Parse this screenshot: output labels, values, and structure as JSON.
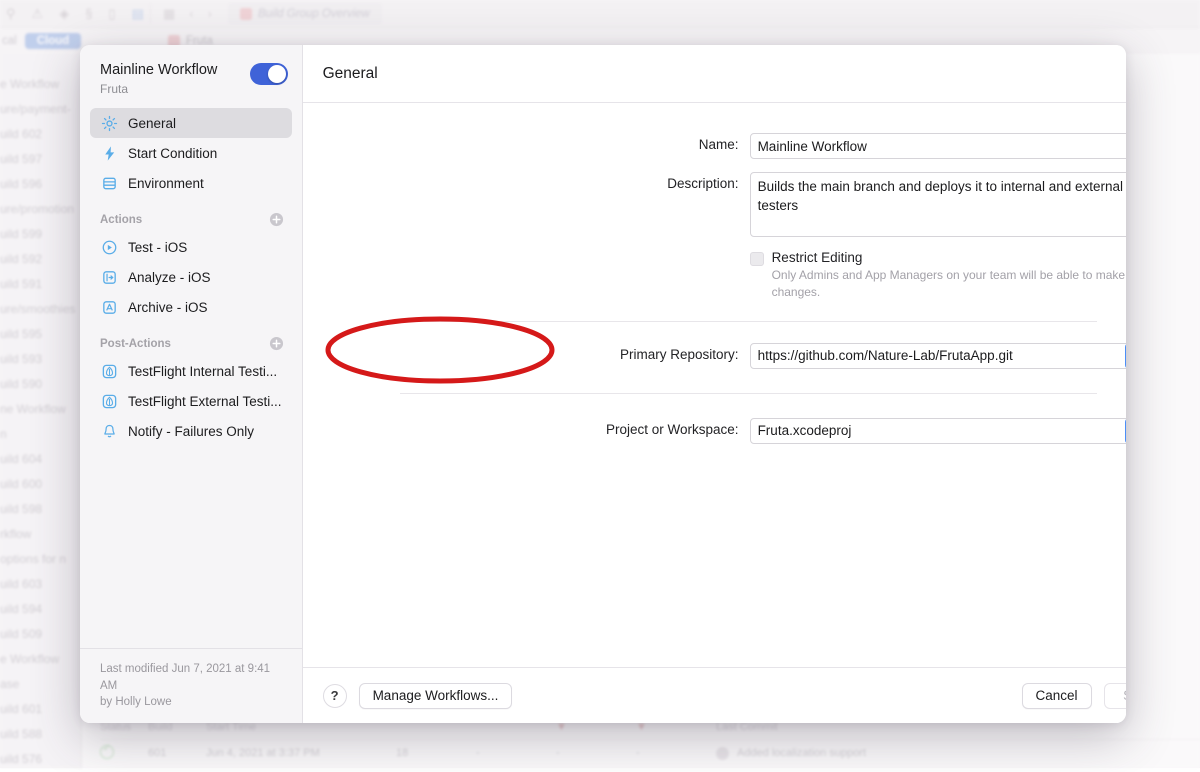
{
  "background": {
    "toolbar": {
      "icons": [
        "search-icon",
        "warning-icon",
        "navigator-icon",
        "source-control-icon",
        "comment-icon",
        "report-icon"
      ],
      "grid_icon": "grid-icon",
      "back_icon": "chevron-left-icon",
      "forward_icon": "chevron-right-icon",
      "tab_label": "Build Group Overview"
    },
    "subbar": {
      "local_label": "cal",
      "cloud_label": "Cloud",
      "project_label": "Fruta"
    },
    "sidebar_rows": [
      "e Workflow",
      "ure/payment-",
      "uild 602",
      "uild 597",
      "uild 596",
      "ure/promotion",
      "uild 599",
      "uild 592",
      "uild 591",
      "ure/smoothies",
      "uild 595",
      "uild 593",
      "uild 590",
      "ne Workflow",
      "n",
      "uild 604",
      "uild 600",
      "uild 598",
      "rkflow",
      "options for n",
      "uild 603",
      "uild 594",
      "uild 509",
      "e Workflow",
      "ase",
      "uild 601",
      "uild 588",
      "uild 576"
    ],
    "table": {
      "headers": [
        "Status",
        "Build",
        "Start Time",
        "",
        "",
        "",
        "",
        "Last Commit"
      ],
      "row": {
        "status": "succeeded",
        "build": "601",
        "start_time": "Jun 4, 2021 at 3:37 PM",
        "tests": "18",
        "col4": "-",
        "col5": "-",
        "col6": "-",
        "last_commit": "Added localization support"
      }
    }
  },
  "sheet": {
    "sidebar": {
      "workflow_name": "Mainline Workflow",
      "workflow_project": "Fruta",
      "toggle_enabled": true,
      "nav": [
        {
          "label": "General",
          "icon": "gear-icon",
          "selected": true
        },
        {
          "label": "Start Condition",
          "icon": "bolt-icon",
          "selected": false
        },
        {
          "label": "Environment",
          "icon": "database-icon",
          "selected": false
        }
      ],
      "actions_group_label": "Actions",
      "actions": [
        {
          "label": "Test - iOS",
          "icon": "test-target-icon"
        },
        {
          "label": "Analyze - iOS",
          "icon": "analyze-icon"
        },
        {
          "label": "Archive - iOS",
          "icon": "archive-icon"
        }
      ],
      "post_actions_group_label": "Post-Actions",
      "post_actions": [
        {
          "label": "TestFlight Internal Testi...",
          "icon": "testflight-icon"
        },
        {
          "label": "TestFlight External Testi...",
          "icon": "testflight-icon"
        },
        {
          "label": "Notify - Failures Only",
          "icon": "bell-icon"
        }
      ],
      "add_action_icon": "plus-circle-icon",
      "footer_line1": "Last modified Jun 7, 2021 at 9:41 AM",
      "footer_line2": "by Holly Lowe"
    },
    "main": {
      "title": "General",
      "name_label": "Name:",
      "name_value": "Mainline Workflow",
      "description_label": "Description:",
      "description_value": "Builds the main branch and deploys it to internal and external testers",
      "restrict_label": "Restrict Editing",
      "restrict_checked": false,
      "restrict_help": "Only Admins and App Managers on your team will be able to make changes.",
      "repo_label": "Primary Repository:",
      "repo_value": "https://github.com/Nature-Lab/FrutaApp.git",
      "repo_dropdown_icon": "chevron-down-icon",
      "project_label": "Project or Workspace:",
      "project_value": "Fruta.xcodeproj",
      "project_stepper_icon": "chevron-up-down-icon"
    },
    "footer": {
      "help_label": "?",
      "manage_label": "Manage Workflows...",
      "cancel_label": "Cancel",
      "save_label": "Save",
      "save_disabled": true
    }
  },
  "annotation": {
    "type": "ellipse-highlight",
    "color": "#d51919",
    "targets": "Primary Repository:"
  }
}
